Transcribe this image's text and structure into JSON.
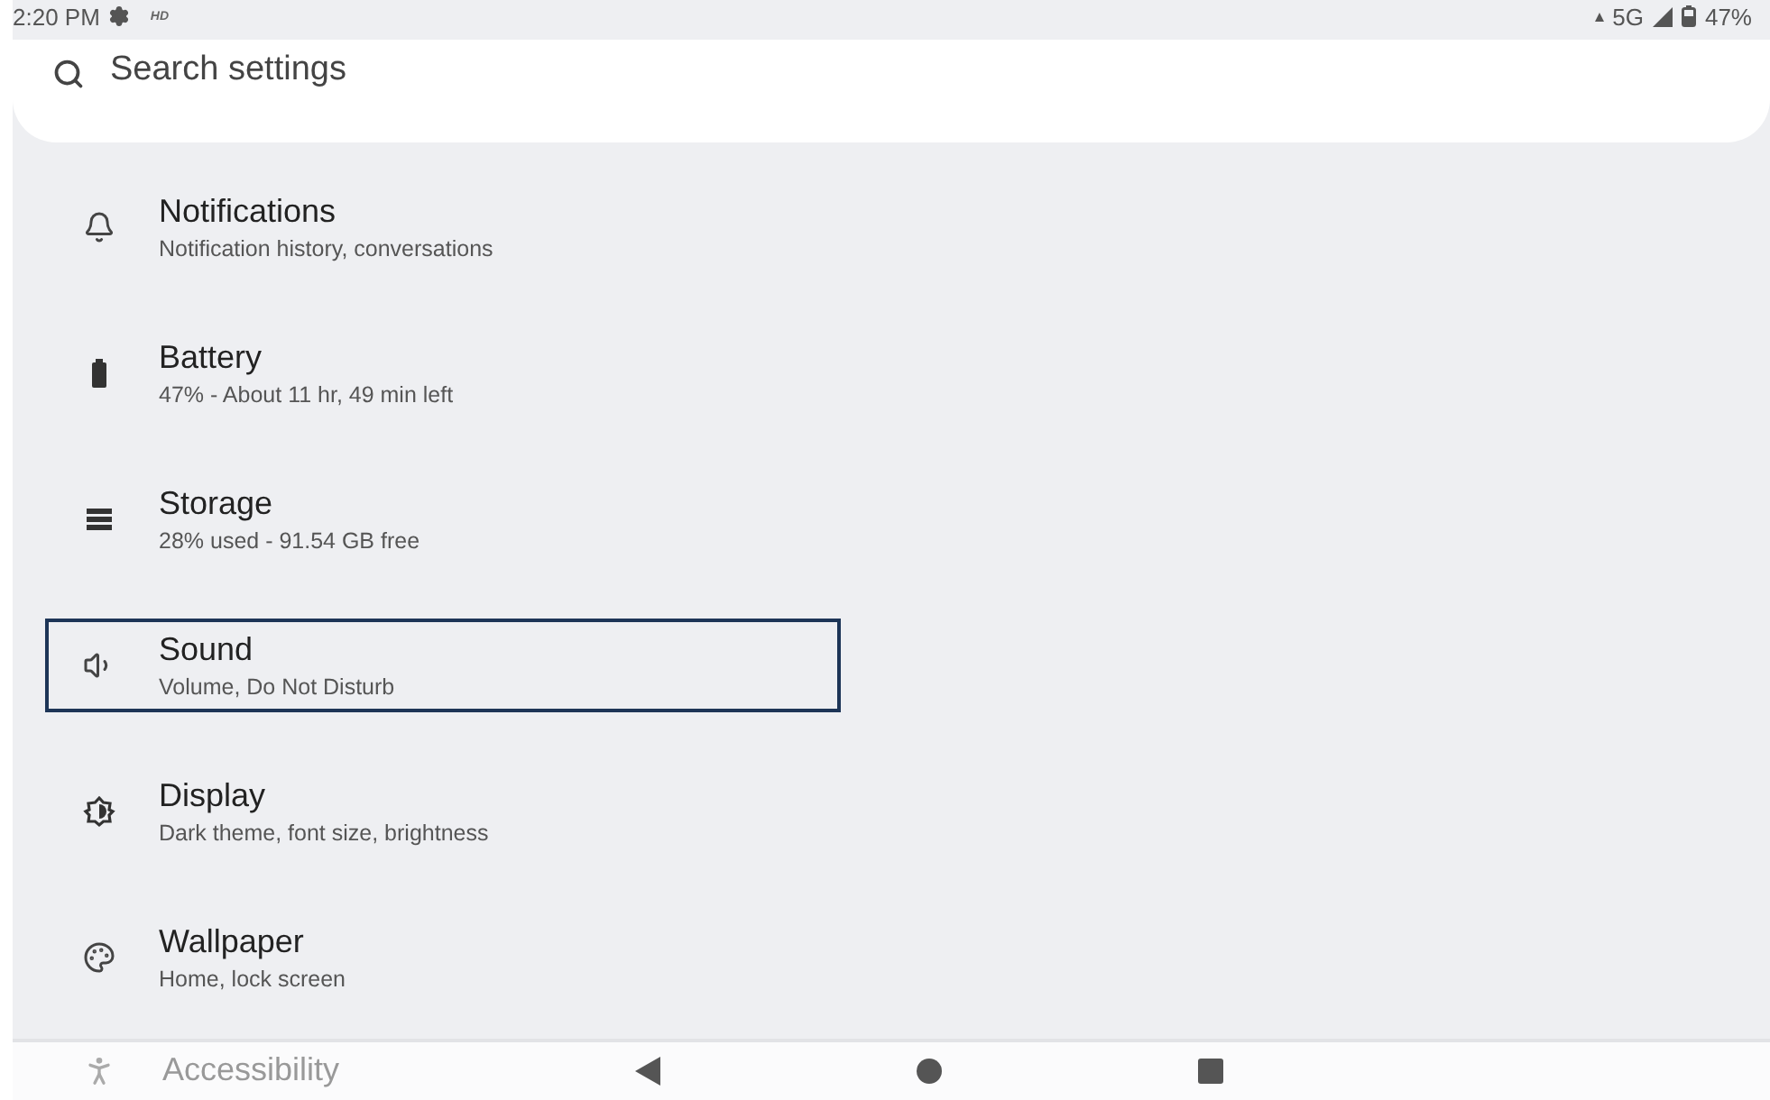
{
  "status_bar": {
    "time": "2:20 PM",
    "hd": "HD",
    "network": "5G",
    "battery": "47%"
  },
  "search": {
    "placeholder": "Search settings"
  },
  "items": [
    {
      "kind": "notifications",
      "title": "Notifications",
      "subtitle": "Notification history, conversations",
      "focused": false
    },
    {
      "kind": "battery",
      "title": "Battery",
      "subtitle": "47% - About 11 hr, 49 min left",
      "focused": false
    },
    {
      "kind": "storage",
      "title": "Storage",
      "subtitle": "28% used - 91.54 GB free",
      "focused": false
    },
    {
      "kind": "sound",
      "title": "Sound",
      "subtitle": "Volume, Do Not Disturb",
      "focused": true
    },
    {
      "kind": "display",
      "title": "Display",
      "subtitle": "Dark theme, font size, brightness",
      "focused": false
    },
    {
      "kind": "wallpaper",
      "title": "Wallpaper",
      "subtitle": "Home, lock screen",
      "focused": false
    },
    {
      "kind": "accessibility",
      "title": "Accessibility",
      "focused": false
    }
  ]
}
